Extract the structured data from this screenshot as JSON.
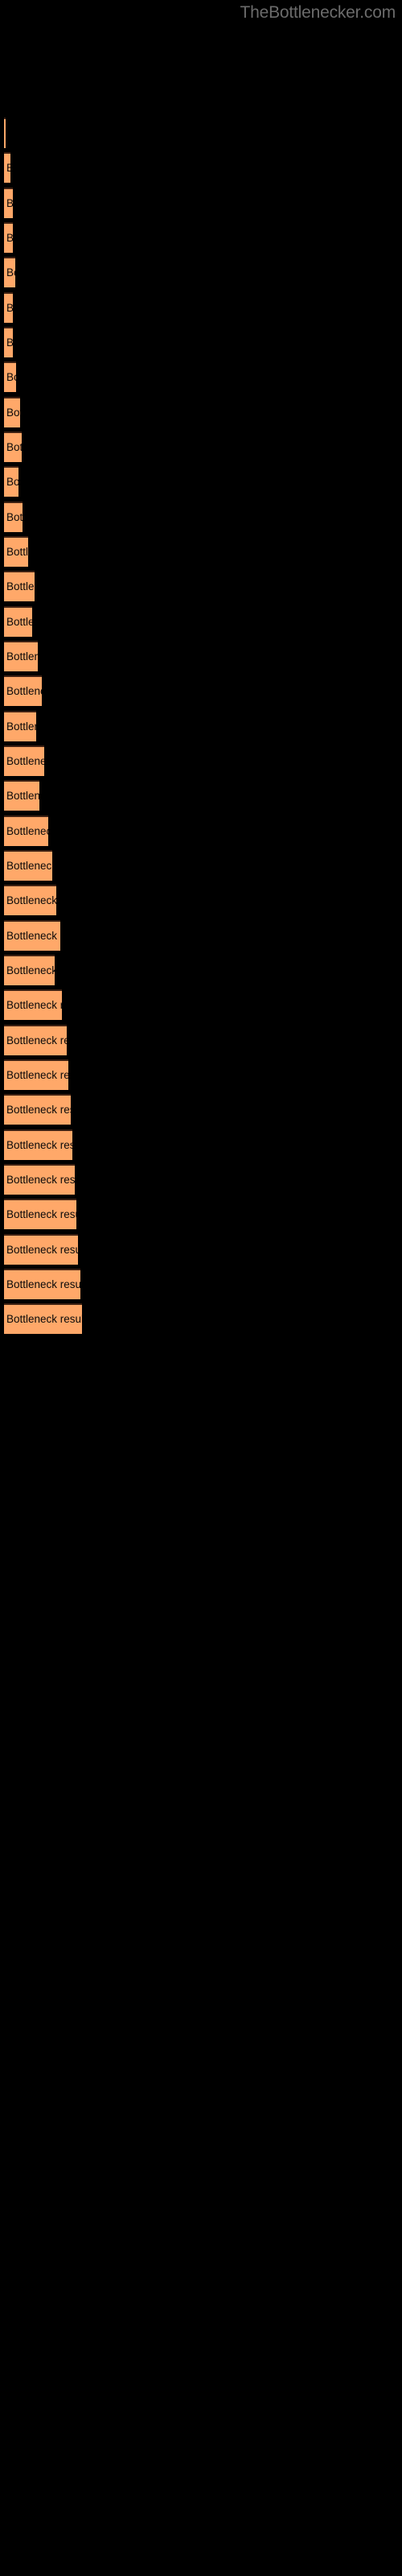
{
  "watermark": "TheBottlenecker.com",
  "colors": {
    "background": "#000000",
    "bar_fill": "#FFA869",
    "bar_edge": "#3d2113",
    "label_text": "#0a0a0a",
    "watermark_text": "#6b6b6b"
  },
  "bar_label": "Bottleneck result",
  "chart_data": {
    "type": "bar",
    "orientation": "horizontal",
    "title": "",
    "subtitle": "",
    "xlabel": "",
    "ylabel": "",
    "grid": false,
    "legend": null,
    "annotations": [
      "TheBottlenecker.com"
    ],
    "bar_text_label": "Bottleneck result",
    "categories": [
      "Bottleneck result",
      "Bottleneck result",
      "Bottleneck result",
      "Bottleneck result",
      "Bottleneck result",
      "Bottleneck result",
      "Bottleneck result",
      "Bottleneck result",
      "Bottleneck result",
      "Bottleneck result",
      "Bottleneck result",
      "Bottleneck result",
      "Bottleneck result",
      "Bottleneck result",
      "Bottleneck result",
      "Bottleneck result",
      "Bottleneck result",
      "Bottleneck result",
      "Bottleneck result",
      "Bottleneck result",
      "Bottleneck result",
      "Bottleneck result",
      "Bottleneck result",
      "Bottleneck result",
      "Bottleneck result",
      "Bottleneck result",
      "Bottleneck result",
      "Bottleneck result",
      "Bottleneck result",
      "Bottleneck result",
      "Bottleneck result",
      "Bottleneck result",
      "Bottleneck result",
      "Bottleneck result",
      "Bottleneck result"
    ],
    "values": [
      2,
      8,
      11,
      11,
      14,
      11,
      11,
      15,
      20,
      22,
      18,
      23,
      30,
      38,
      35,
      42,
      47,
      40,
      50,
      44,
      55,
      60,
      65,
      70,
      63,
      72,
      78,
      80,
      83,
      85,
      88,
      90,
      92,
      95,
      97
    ],
    "ylim": [
      0,
      100
    ],
    "xlim": [
      0,
      100
    ],
    "bar_pixel_tops": [
      146,
      189,
      233,
      276,
      319,
      363,
      406,
      449,
      493,
      536,
      579,
      623,
      666,
      709,
      753,
      796,
      839,
      883,
      926,
      969,
      1013,
      1056,
      1099,
      1143,
      1186,
      1229,
      1273,
      1316,
      1359,
      1403,
      1446,
      1489,
      1533,
      1576,
      1619
    ]
  }
}
